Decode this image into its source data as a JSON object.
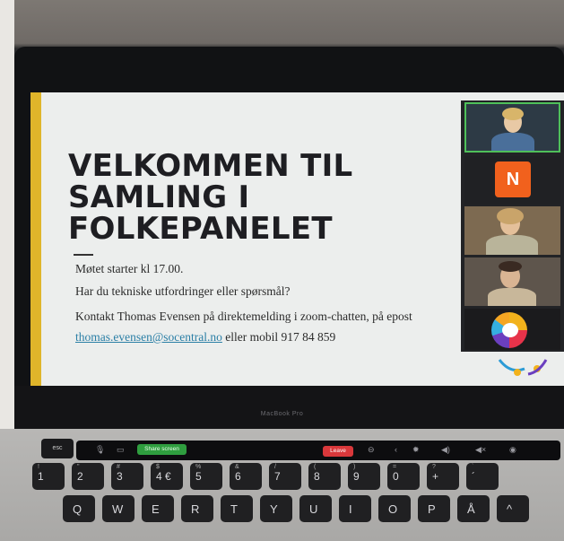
{
  "slide": {
    "title_lines": [
      "VELKOMMEN TIL",
      "SAMLING I",
      "FOLKEPANELET"
    ],
    "line1": "Møtet starter kl 17.00.",
    "line2": "Har du tekniske utfordringer eller spørsmål?",
    "line3": "Kontakt Thomas Evensen på direktemelding i zoom-chatten, på epost",
    "email": "thomas.evensen@socentral.no",
    "line4_suffix": " eller mobil 917 84 859"
  },
  "participants": {
    "avatar_letter": "N"
  },
  "laptop": {
    "brand": "MacBook Pro"
  },
  "touchbar": {
    "esc": "esc",
    "share": "Share screen",
    "leave": "Leave"
  },
  "keys": {
    "number_row": [
      {
        "top": "!",
        "main": "1"
      },
      {
        "top": "\"",
        "main": "2"
      },
      {
        "top": "#",
        "main": "3"
      },
      {
        "top": "$",
        "main": "4 €"
      },
      {
        "top": "%",
        "main": "5"
      },
      {
        "top": "&",
        "main": "6"
      },
      {
        "top": "/",
        "main": "7"
      },
      {
        "top": "(",
        "main": "8"
      },
      {
        "top": ")",
        "main": "9"
      },
      {
        "top": "=",
        "main": "0"
      },
      {
        "top": "?",
        "main": "+"
      },
      {
        "top": "`",
        "main": "´"
      }
    ],
    "letter_row": [
      "Q",
      "W",
      "E",
      "R",
      "T",
      "Y",
      "U",
      "I",
      "O",
      "P",
      "Å",
      "^"
    ]
  },
  "colors": {
    "slide_accent": "#e0b52a",
    "avatar_bg": "#f1611d",
    "active_speaker_border": "#4fc05a",
    "share_button": "#2f9e3f",
    "leave_button": "#d9383b",
    "link": "#2b7fa6"
  }
}
